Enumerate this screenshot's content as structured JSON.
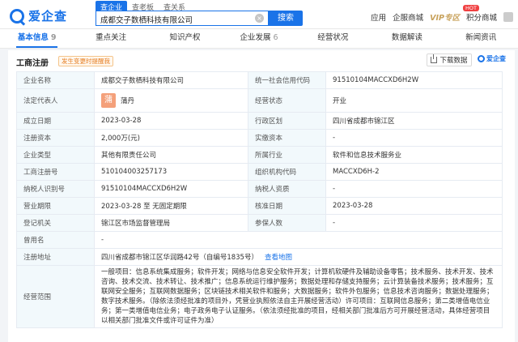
{
  "app": {
    "logo_text": "爱企查",
    "brand_color": "#1a73e8"
  },
  "search": {
    "tabs": [
      "查企业",
      "查老板",
      "查关系"
    ],
    "active_tab": "查企业",
    "query": "成都交子数栖科技有限公司",
    "button_label": "搜索"
  },
  "top_right": {
    "items": [
      "应用",
      "企服商城",
      "VIP专区",
      "积分商城"
    ],
    "hot_badge": "HOT"
  },
  "nav": [
    {
      "label": "基本信息",
      "count": "9",
      "active": true
    },
    {
      "label": "重点关注",
      "count": "",
      "active": false
    },
    {
      "label": "知识产权",
      "count": "",
      "active": false
    },
    {
      "label": "企业发展",
      "count": "6",
      "active": false
    },
    {
      "label": "经营状况",
      "count": "",
      "active": false
    },
    {
      "label": "数据解读",
      "count": "",
      "active": false
    },
    {
      "label": "新闻资讯",
      "count": "",
      "active": false
    }
  ],
  "panel": {
    "title": "工商注册",
    "notice": "发生变更时提醒我",
    "download_label": "下载数据",
    "brand_mark": "爱企查"
  },
  "registration": {
    "company_name_label": "企业名称",
    "company_name": "成都交子数栖科技有限公司",
    "credit_code_label": "统一社会信用代码",
    "credit_code": "91510104MACCXD6H2W",
    "legal_rep_label": "法定代表人",
    "legal_rep_avatar": "蒲",
    "legal_rep": "蒲丹",
    "status_label": "经营状态",
    "status": "开业",
    "founded_label": "成立日期",
    "founded": "2023-03-28",
    "district_label": "行政区划",
    "district": "四川省成都市锦江区",
    "capital_label": "注册资本",
    "capital": "2,000万(元)",
    "paid_capital_label": "实缴资本",
    "paid_capital": "-",
    "type_label": "企业类型",
    "type": "其他有限责任公司",
    "industry_label": "所属行业",
    "industry": "软件和信息技术服务业",
    "reg_no_label": "工商注册号",
    "reg_no": "510104003257173",
    "org_code_label": "组织机构代码",
    "org_code": "MACCXD6H-2",
    "taxpayer_no_label": "纳税人识别号",
    "taxpayer_no": "91510104MACCXD6H2W",
    "taxpayer_qual_label": "纳税人资质",
    "taxpayer_qual": "-",
    "term_label": "营业期限",
    "term": "2023-03-28 至 无固定期限",
    "approval_date_label": "核准日期",
    "approval_date": "2023-03-28",
    "authority_label": "登记机关",
    "authority": "锦江区市场监督管理局",
    "insured_label": "参保人数",
    "insured": "-",
    "former_name_label": "曾用名",
    "former_name": "-",
    "address_label": "注册地址",
    "address": "四川省成都市锦江区华润路42号（自编号1835号）",
    "map_link": "查看地图",
    "scope_label": "经营范围",
    "scope": "一般项目：信息系统集成服务；软件开发；网络与信息安全软件开发；计算机软硬件及辅助设备零售；技术服务、技术开发、技术咨询、技术交流、技术转让、技术推广；信息系统运行维护服务；数据处理和存储支持服务；云计算装备技术服务；技术服务；互联网安全服务；互联网数据服务；区块链技术相关软件和服务；大数据服务；软件外包服务；信息技术咨询服务；数据处理服务；数字技术服务。（除依法须经批准的项目外，凭营业执照依法自主开展经营活动）许可项目：互联网信息服务；第二类增值电信业务；第一类增值电信业务；电子政务电子认证服务。（依法须经批准的项目，经相关部门批准后方可开展经营活动，具体经营项目以相关部门批准文件或许可证件为准）"
  }
}
